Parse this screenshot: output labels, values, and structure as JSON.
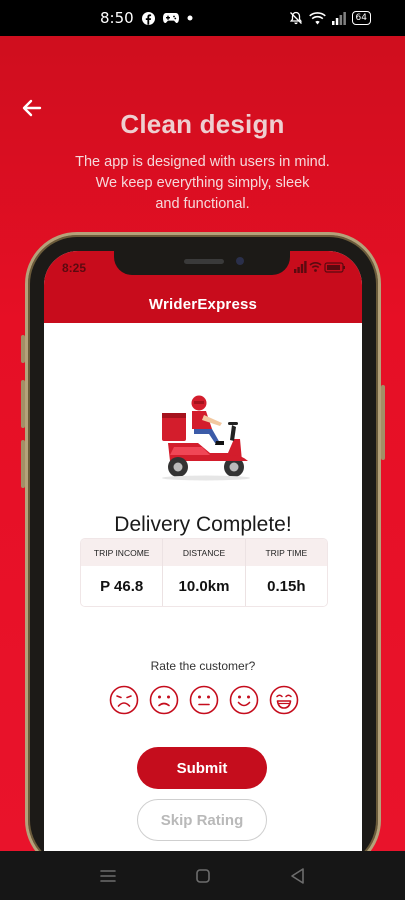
{
  "status_bar": {
    "time": "8:50",
    "battery": "64",
    "left_icons": [
      "facebook-icon",
      "game-controller-icon",
      "dot-icon"
    ],
    "right_icons": [
      "bell-off-icon",
      "wifi-icon",
      "signal-icon",
      "battery-icon"
    ]
  },
  "hero": {
    "title": "Clean design",
    "subtitle_lines": [
      "The app is designed with users in mind.",
      "We keep everything simply, sleek",
      "and functional."
    ]
  },
  "mockup": {
    "time": "8:25",
    "app_title": "WriderExpress",
    "delivery_title": "Delivery Complete!",
    "stats": [
      {
        "label": "TRIP INCOME",
        "value": "P 46.8"
      },
      {
        "label": "DISTANCE",
        "value": "10.0km"
      },
      {
        "label": "TRIP TIME",
        "value": "0.15h"
      }
    ],
    "rate_label": "Rate the customer?",
    "faces": [
      "sad-face-icon",
      "frown-face-icon",
      "neutral-face-icon",
      "smile-face-icon",
      "laugh-face-icon"
    ],
    "submit_label": "Submit",
    "skip_label": "Skip Rating"
  },
  "colors": {
    "brand_red": "#c80c1c",
    "background_red": "#e60f25"
  },
  "nav_bar": {
    "icons": [
      "menu-icon",
      "home-square-icon",
      "back-triangle-icon"
    ]
  }
}
